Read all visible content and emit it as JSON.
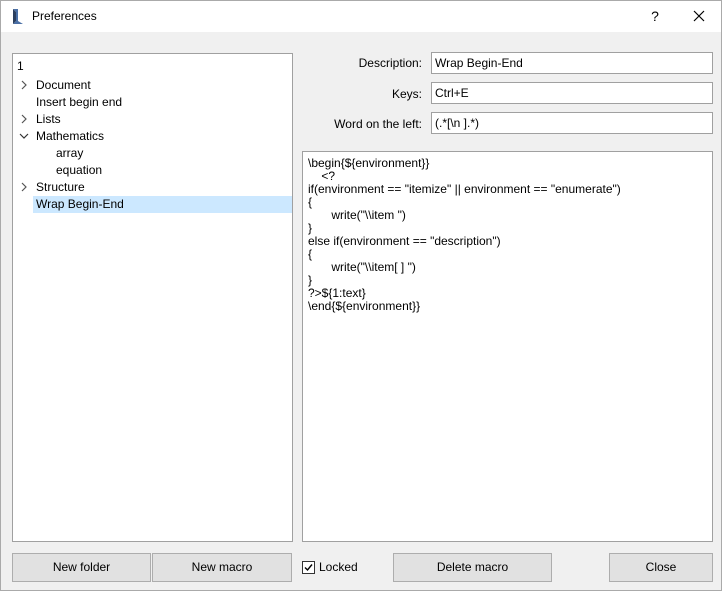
{
  "window": {
    "title": "Preferences",
    "help_label": "?"
  },
  "tree": {
    "root_label": "1",
    "items": [
      {
        "label": "Document",
        "expandable": true,
        "expanded": false
      },
      {
        "label": "Insert begin end",
        "expandable": false
      },
      {
        "label": "Lists",
        "expandable": true,
        "expanded": false
      },
      {
        "label": "Mathematics",
        "expandable": true,
        "expanded": true
      },
      {
        "label": "array",
        "child": true
      },
      {
        "label": "equation",
        "child": true
      },
      {
        "label": "Structure",
        "expandable": true,
        "expanded": false
      },
      {
        "label": "Wrap Begin-End",
        "selected": true
      }
    ]
  },
  "form": {
    "description_label": "Description:",
    "description_value": "Wrap Begin-End",
    "keys_label": "Keys:",
    "keys_value": "Ctrl+E",
    "word_left_label": "Word on the left:",
    "word_left_value": "(.*[\\n ].*)"
  },
  "editor": {
    "lines": [
      "\\begin{${environment}}",
      "    <?",
      "if(environment == \"itemize\" || environment == \"enumerate\")",
      "{",
      "       write(\"\\\\item \")",
      "}",
      "else if(environment == \"description\")",
      "{",
      "       write(\"\\\\item[ ] \")",
      "}",
      "?>${1:text}",
      "\\end{${environment}}"
    ]
  },
  "buttons": {
    "new_folder": "New folder",
    "new_macro": "New macro",
    "locked_label": "Locked",
    "locked_checked": true,
    "delete_macro": "Delete macro",
    "close": "Close"
  }
}
